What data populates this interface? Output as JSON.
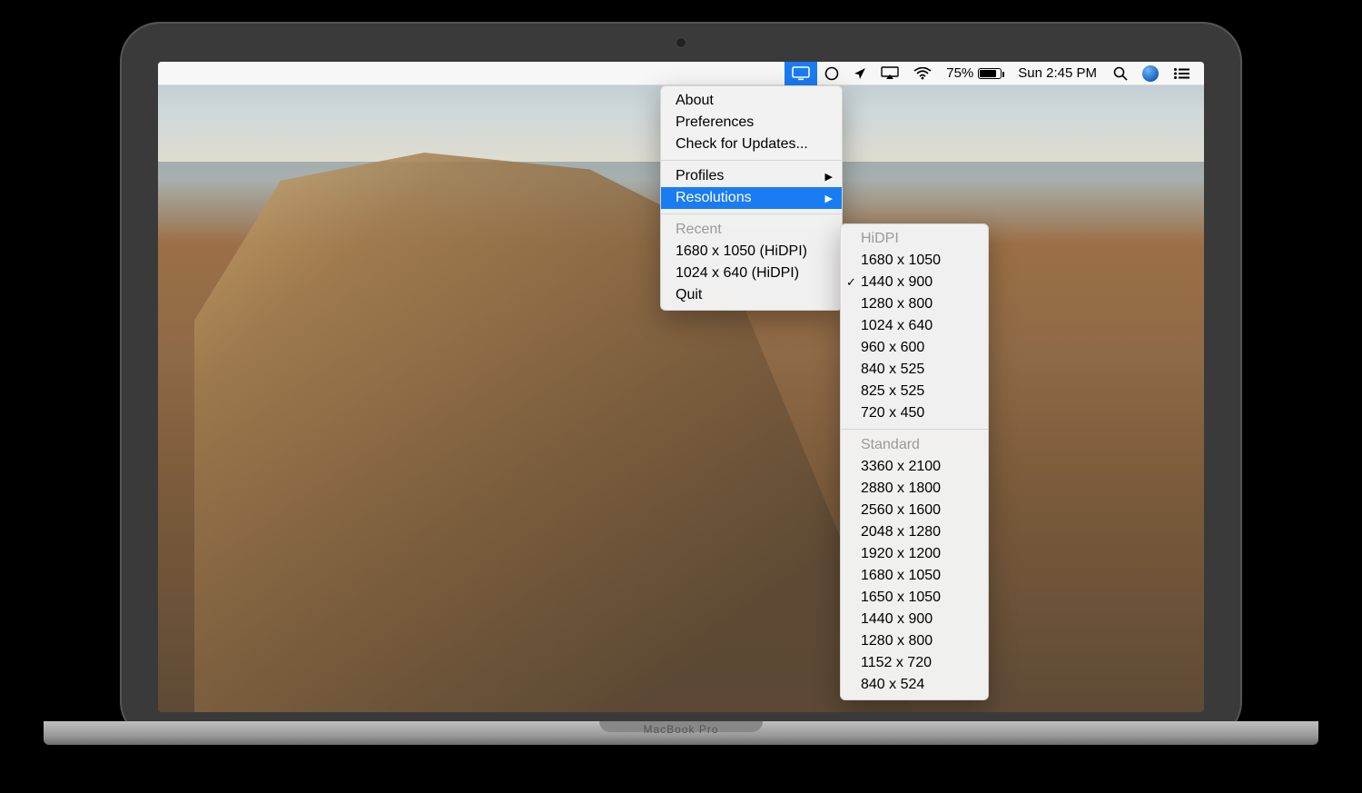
{
  "device_label": "MacBook Pro",
  "menubar": {
    "battery_percent": "75%",
    "clock": "Sun 2:45 PM"
  },
  "menu": {
    "about": "About",
    "preferences": "Preferences",
    "check_updates": "Check for Updates...",
    "profiles": "Profiles",
    "resolutions": "Resolutions",
    "recent_header": "Recent",
    "recent_items": [
      "1680 x 1050 (HiDPI)",
      "1024 x 640 (HiDPI)"
    ],
    "quit": "Quit"
  },
  "submenu": {
    "hidpi_header": "HiDPI",
    "hidpi": [
      "1680 x 1050",
      "1440 x 900",
      "1280 x 800",
      "1024 x 640",
      "960 x 600",
      "840 x 525",
      "825 x 525",
      "720 x 450"
    ],
    "selected": "1440 x 900",
    "standard_header": "Standard",
    "standard": [
      "3360 x 2100",
      "2880 x 1800",
      "2560 x 1600",
      "2048 x 1280",
      "1920 x 1200",
      "1680 x 1050",
      "1650 x 1050",
      "1440 x 900",
      "1280 x 800",
      "1152 x 720",
      "840 x 524"
    ]
  }
}
